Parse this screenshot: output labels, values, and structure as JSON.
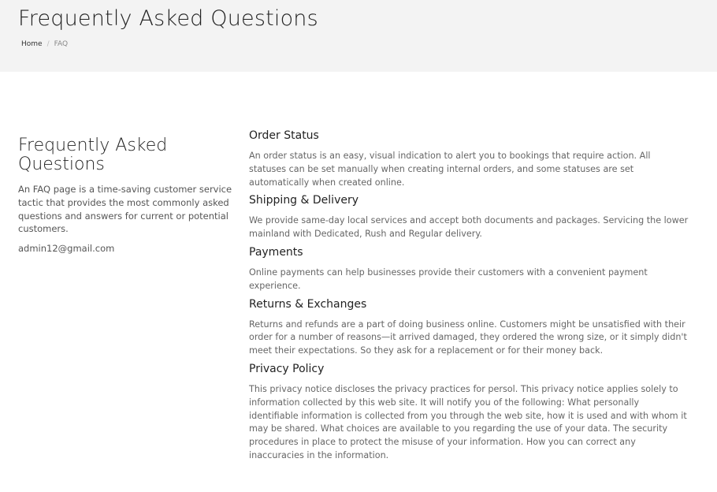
{
  "header": {
    "title": "Frequently Asked Questions",
    "breadcrumb": {
      "home": "Home",
      "separator": "/",
      "current": "FAQ"
    }
  },
  "intro": {
    "title": "Frequently Asked Questions",
    "text": "An FAQ page is a time-saving customer service tactic that provides the most commonly asked questions and answers for current or potential customers.",
    "email": "admin12@gmail.com"
  },
  "faq": [
    {
      "question": "Order Status",
      "answer": "An order status is an easy, visual indication to alert you to bookings that require action. All statuses can be set manually when creating internal orders, and some statuses are set automatically when created online."
    },
    {
      "question": "Shipping & Delivery",
      "answer": "We provide same-day local services and accept both documents and packages. Servicing the lower mainland with Dedicated, Rush and Regular delivery."
    },
    {
      "question": "Payments",
      "answer": "Online payments can help businesses provide their customers with a convenient payment experience."
    },
    {
      "question": "Returns & Exchanges",
      "answer": "Returns and refunds are a part of doing business online. Customers might be unsatisfied with their order for a number of reasons—it arrived damaged, they ordered the wrong size, or it simply didn't meet their expectations. So they ask for a replacement or for their money back."
    },
    {
      "question": "Privacy Policy",
      "answer": "This privacy notice discloses the privacy practices for persol. This privacy notice applies solely to information collected by this web site. It will notify you of the following: What personally identifiable information is collected from you through the web site, how it is used and with whom it may be shared. What choices are available to you regarding the use of your data. The security procedures in place to protect the misuse of your information. How you can correct any inaccuracies in the information."
    }
  ]
}
